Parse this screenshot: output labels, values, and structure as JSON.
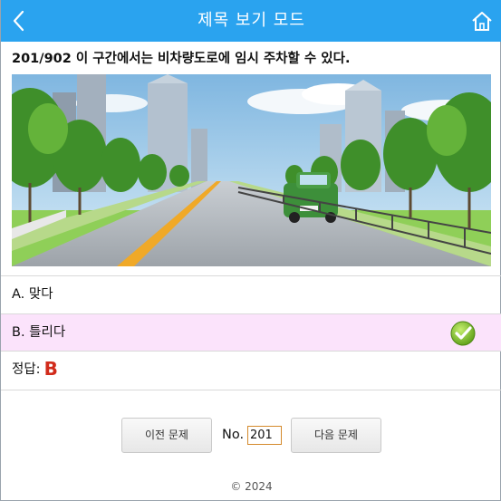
{
  "header": {
    "title": "제목 보기 모드",
    "back_icon": "chevron-left-icon",
    "home_icon": "home-icon",
    "bg_color": "#2aa3ef"
  },
  "question": {
    "text": "201/902 이 구간에서는 비차량도로에 임시 주차할 수 있다."
  },
  "options": [
    {
      "label": "A. 맞다"
    },
    {
      "label": "B. 틀리다",
      "selected": true,
      "icon": "checkmark-icon"
    }
  ],
  "answer": {
    "label": "정답:",
    "value": "B"
  },
  "navigation": {
    "prev_label": "이전 문제",
    "no_label": "No.",
    "current_number": "201",
    "next_label": "다음 문제"
  },
  "footer": {
    "copyright": "© 2024"
  }
}
